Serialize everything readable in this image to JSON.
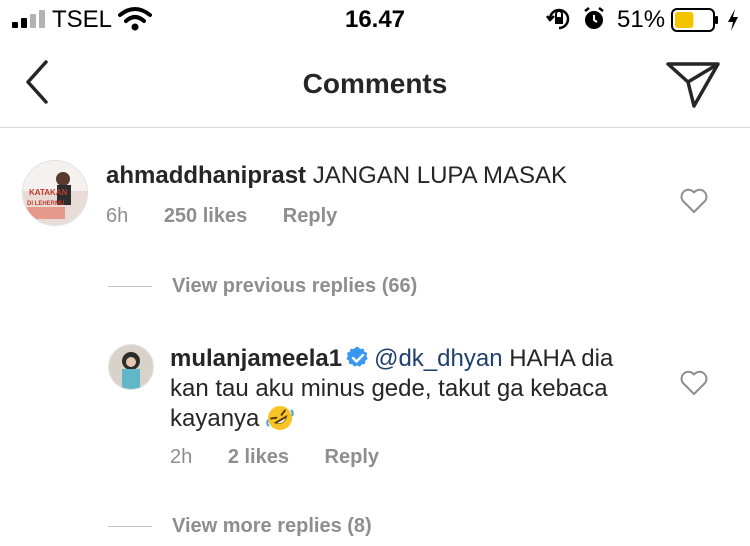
{
  "status_bar": {
    "carrier": "TSEL",
    "time": "16.47",
    "battery_percent": "51%",
    "battery_level": 0.51,
    "icons": [
      "signal-icon",
      "wifi-icon",
      "rotation-lock-icon",
      "alarm-icon",
      "battery-icon",
      "charging-icon"
    ]
  },
  "nav": {
    "title": "Comments",
    "back_icon": "chevron-left-icon",
    "share_icon": "send-icon"
  },
  "comment": {
    "username": "ahmaddhaniprast",
    "text": "JANGAN LUPA MASAK",
    "time": "6h",
    "likes": "250 likes",
    "reply": "Reply",
    "avatar_text": "KATAKAN",
    "avatar_text_2": "DI LEHERMU"
  },
  "view_previous": "View previous replies (66)",
  "reply": {
    "username": "mulanjameela1",
    "mention": "@dk_dhyan",
    "text_line1": "HAHA dia",
    "text_line2": "kan tau aku minus gede, takut ga kebaca",
    "text_line3": "kayanya",
    "emoji": "rolling-on-floor-laughing-emoji",
    "time": "2h",
    "likes": "2 likes",
    "reply": "Reply"
  },
  "view_more": "View more replies (8)",
  "colors": {
    "text": "#262626",
    "secondary": "#8e8e8e",
    "mention": "#1f3f6e",
    "verified": "#3897f0",
    "battery": "#f5c400"
  }
}
